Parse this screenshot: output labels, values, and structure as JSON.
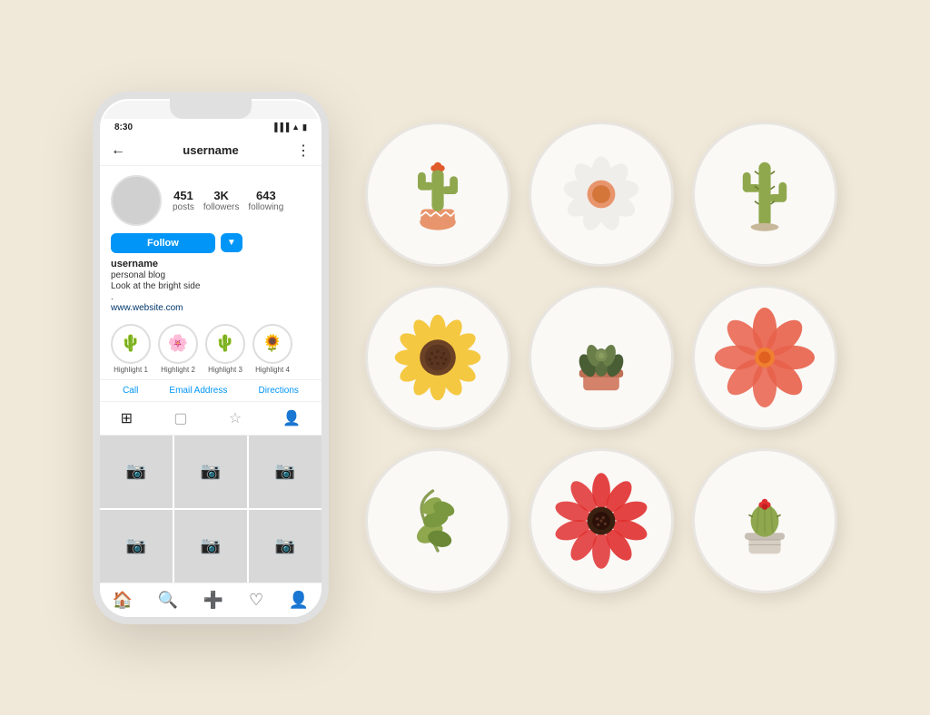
{
  "page": {
    "bg_color": "#f0e8d8"
  },
  "phone": {
    "status_time": "8:30",
    "header": {
      "back_label": "←",
      "username": "username",
      "more_label": "⋮"
    },
    "stats": [
      {
        "value": "451",
        "label": "posts"
      },
      {
        "value": "3K",
        "label": "followers"
      },
      {
        "value": "643",
        "label": "following"
      }
    ],
    "follow_button": "Follow",
    "profile": {
      "name": "username",
      "bio_line1": "personal blog",
      "bio_line2": "Look at the bright side",
      "bio_line3": ".",
      "link": "www.website.com"
    },
    "highlights": [
      {
        "label": "Highlight 1",
        "emoji": "🌵"
      },
      {
        "label": "Highlight 2",
        "emoji": "🌸"
      },
      {
        "label": "Highlight 3",
        "emoji": "🌵"
      },
      {
        "label": "Highlight 4",
        "emoji": "🌻"
      }
    ],
    "action_links": [
      "Call",
      "Email Address",
      "Directions"
    ],
    "nav_icons": [
      "🏠",
      "🔍",
      "➕",
      "❤️",
      "👤"
    ]
  },
  "icons": [
    {
      "id": "cactus-pot",
      "type": "cactus_pot_orange"
    },
    {
      "id": "white-flower",
      "type": "white_flower"
    },
    {
      "id": "tall-cactus",
      "type": "tall_cactus"
    },
    {
      "id": "sunflower",
      "type": "sunflower"
    },
    {
      "id": "succulent-pot",
      "type": "succulent_pot"
    },
    {
      "id": "red-flower",
      "type": "red_flower"
    },
    {
      "id": "leaves",
      "type": "leaves"
    },
    {
      "id": "red-daisy",
      "type": "red_daisy"
    },
    {
      "id": "small-cactus",
      "type": "small_cactus"
    }
  ]
}
